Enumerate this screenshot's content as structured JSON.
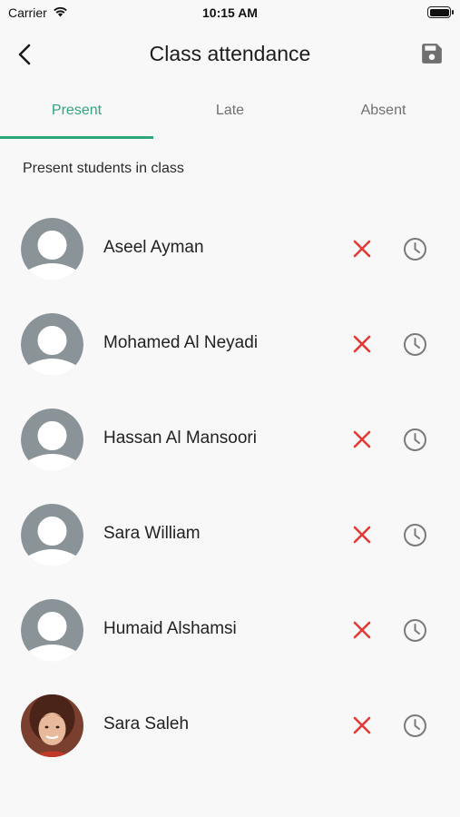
{
  "status_bar": {
    "carrier": "Carrier",
    "time": "10:15 AM"
  },
  "header": {
    "title": "Class attendance"
  },
  "tabs": [
    {
      "label": "Present",
      "active": true
    },
    {
      "label": "Late",
      "active": false
    },
    {
      "label": "Absent",
      "active": false
    }
  ],
  "section_label": "Present students in class",
  "students": [
    {
      "name": "Aseel Ayman",
      "avatar": "placeholder-avatar"
    },
    {
      "name": "Mohamed Al Neyadi",
      "avatar": "placeholder-avatar"
    },
    {
      "name": "Hassan Al Mansoori",
      "avatar": "placeholder-avatar"
    },
    {
      "name": "Sara William",
      "avatar": "placeholder-avatar"
    },
    {
      "name": "Humaid Alshamsi",
      "avatar": "placeholder-avatar"
    },
    {
      "name": "Sara Saleh",
      "avatar": "photo-avatar"
    }
  ],
  "colors": {
    "accent": "#2fa57a",
    "absent_mark": "#e53935",
    "late_icon": "#7a7a7a",
    "avatar_placeholder": "#8a9397",
    "background": "#f8f8f8"
  }
}
